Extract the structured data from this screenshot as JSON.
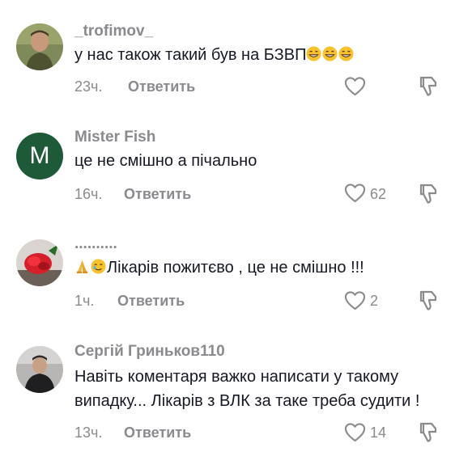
{
  "comments": [
    {
      "username": "_trofimov_",
      "text": "у нас також такий був на БЗВП",
      "emoji_trail": [
        "grin-icon",
        "grin-icon",
        "grin-icon"
      ],
      "time": "23ч.",
      "reply_label": "Ответить",
      "likes": ""
    },
    {
      "username": "Mister Fish",
      "avatar_letter": "M",
      "avatar_color": "#1f5a38",
      "text": "це не смішно а пічально",
      "time": "16ч.",
      "reply_label": "Ответить",
      "likes": "62"
    },
    {
      "username": "..........",
      "emoji_lead": [
        "folded-hands-icon",
        "tearful-smile-icon"
      ],
      "text": "Лікарів пожитєво , це не смішно !!!",
      "time": "1ч.",
      "reply_label": "Ответить",
      "likes": "2"
    },
    {
      "username": "Сергій Гриньков110",
      "text_lines": [
        "Навіть коментаря важко написати у такому",
        "випадку... Лікарів з ВЛК за таке треба судити !"
      ],
      "time": "13ч.",
      "reply_label": "Ответить",
      "likes": "14"
    }
  ],
  "colors": {
    "text": "#161823",
    "muted": "#8a8a8f",
    "avatar_green": "#1f5a38"
  }
}
